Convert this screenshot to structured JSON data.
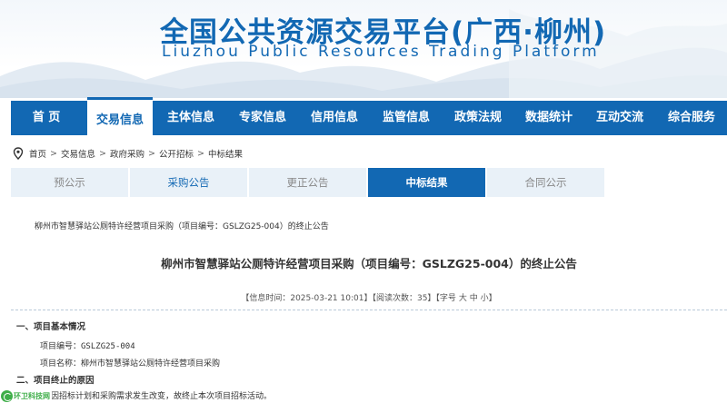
{
  "site": {
    "title": "全国公共资源交易平台(广西·柳州)",
    "subtitle": "Liuzhou Public Resources Trading Platform"
  },
  "nav": {
    "items": [
      "首 页",
      "交易信息",
      "主体信息",
      "专家信息",
      "信用信息",
      "监管信息",
      "政策法规",
      "数据统计",
      "互动交流",
      "综合服务"
    ],
    "active_index": 1
  },
  "breadcrumb": {
    "items": [
      "首页",
      "交易信息",
      "政府采购",
      "公开招标",
      "中标结果"
    ],
    "separator": ">"
  },
  "tabs": {
    "items": [
      "预公示",
      "采购公告",
      "更正公告",
      "中标结果",
      "合同公示"
    ],
    "active_index": 3
  },
  "notice": {
    "small_title": "柳州市智慧驿站公厕特许经营项目采购（项目编号：GSLZG25-004）的终止公告",
    "title": "柳州市智慧驿站公厕特许经营项目采购（项目编号：GSLZG25-004）的终止公告",
    "meta_publish": "【信息时间：2025-03-21 10:01】",
    "meta_views": "【阅读次数：35】",
    "meta_font_label": "【字号",
    "meta_font_large": "大",
    "meta_font_medium": "中",
    "meta_font_small": "小",
    "meta_font_close": "】",
    "section1": "一、项目基本情况",
    "project_code_label": "项目编号：",
    "project_code": "GSLZG25-004",
    "project_name_label": "项目名称：",
    "project_name": "柳州市智慧驿站公厕特许经营项目采购",
    "section2": "二、项目终止的原因",
    "reason": "因招标计划和采购需求发生改变，故终止本次项目招标活动。"
  },
  "badge": {
    "text": "环卫科技网"
  },
  "colors": {
    "primary": "#1268b3",
    "tab_inactive_bg": "#e9f1f8",
    "badge_green": "#3fae49"
  },
  "icons": {
    "breadcrumb": "location-pin-icon",
    "badge": "env-tech-logo-icon"
  }
}
